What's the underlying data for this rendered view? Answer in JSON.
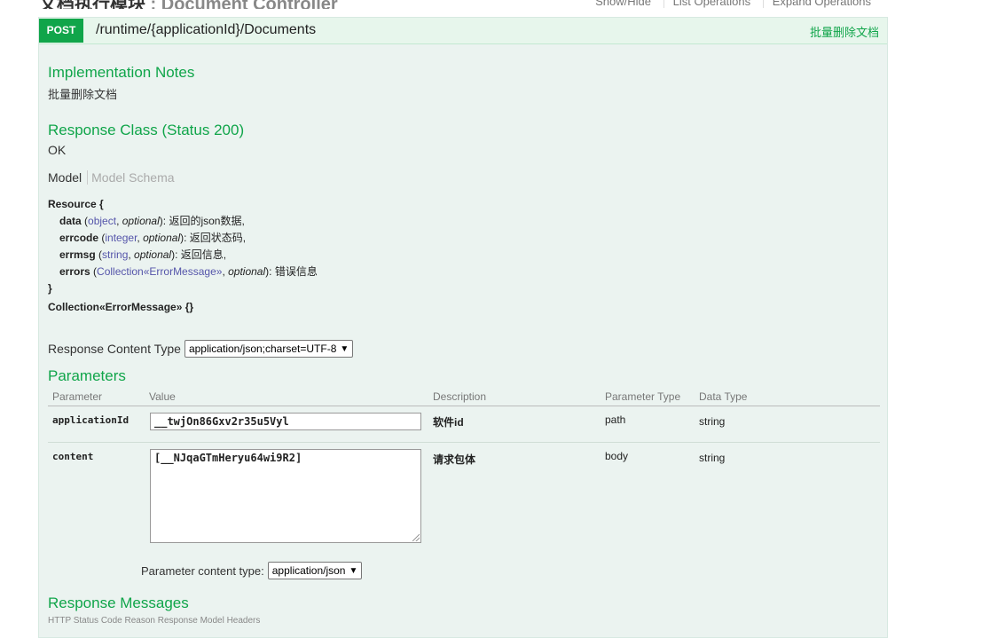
{
  "header": {
    "title": "文档执行模块",
    "subtitle": " : Document Controller",
    "links": [
      "Show/Hide",
      "List Operations",
      "Expand Operations"
    ]
  },
  "operation": {
    "method": "POST",
    "path": "/runtime/{applicationId}/Documents",
    "summary": "批量删除文档"
  },
  "impl_notes": {
    "heading": "Implementation Notes",
    "text": "批量删除文档"
  },
  "response_class": {
    "heading": "Response Class (Status 200)",
    "text": "OK",
    "tab_model": "Model",
    "tab_schema": "Model Schema"
  },
  "schema": {
    "resource_open": "Resource {",
    "fields": [
      {
        "name": "data",
        "type": "object",
        "opt": "optional",
        "desc": "返回的json数据,"
      },
      {
        "name": "errcode",
        "type": "integer",
        "opt": "optional",
        "desc": "返回状态码,"
      },
      {
        "name": "errmsg",
        "type": "string",
        "opt": "optional",
        "desc": "返回信息,"
      },
      {
        "name": "errors",
        "type": "Collection«ErrorMessage»",
        "opt": "optional",
        "desc": "错误信息"
      }
    ],
    "close": "}",
    "collection": "Collection«ErrorMessage» {}"
  },
  "response_content_type": {
    "label": "Response Content Type",
    "value": "application/json;charset=UTF-8"
  },
  "parameters": {
    "heading": "Parameters",
    "columns": [
      "Parameter",
      "Value",
      "Description",
      "Parameter Type",
      "Data Type"
    ],
    "rows": [
      {
        "name": "applicationId",
        "value": "__twjOn86Gxv2r35u5Vyl",
        "description": "软件id",
        "param_type": "path",
        "data_type": "string"
      },
      {
        "name": "content",
        "value": "[__NJqaGTmHeryu64wi9R2]",
        "description": "请求包体",
        "param_type": "body",
        "data_type": "string"
      }
    ],
    "content_type_label": "Parameter content type:",
    "content_type_value": "application/json"
  },
  "response_messages": {
    "heading": "Response Messages",
    "partial": "HTTP Status Code    Reason                              Response Model                                                    Headers"
  }
}
